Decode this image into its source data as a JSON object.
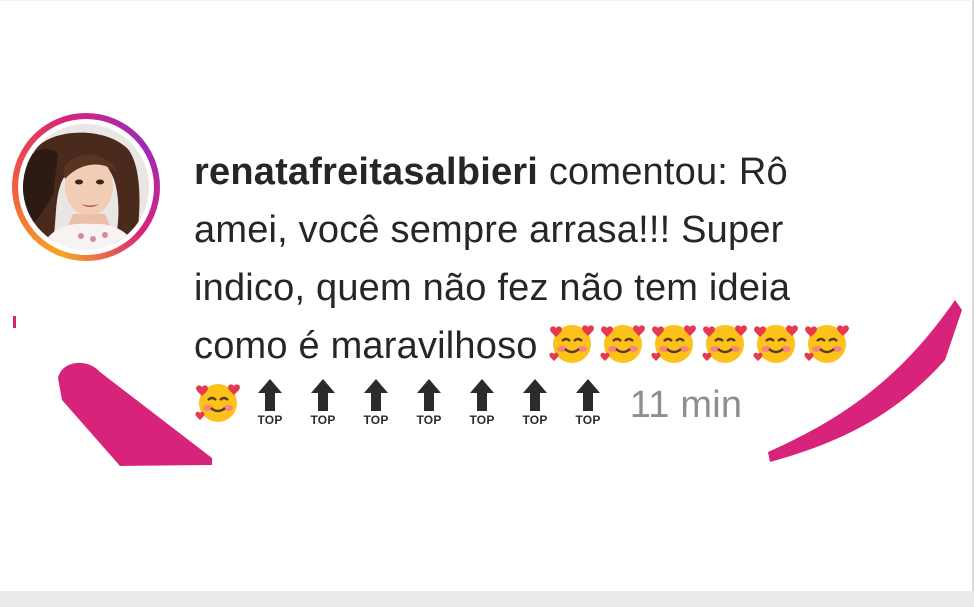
{
  "comment": {
    "username": "renatafreitasalbieri",
    "action": "comentou:",
    "lines": [
      "Rô",
      "amei, você sempre arrasa!!! Super",
      "indico, quem não fez não tem ideia",
      "como é maravilhoso"
    ],
    "emoji_love": "smiling-face-with-hearts",
    "top_label": "TOP",
    "timestamp": "11 min"
  },
  "colors": {
    "accent_pink": "#d7247a",
    "timestamp_gray": "#8e8e8e",
    "text": "#262626"
  }
}
